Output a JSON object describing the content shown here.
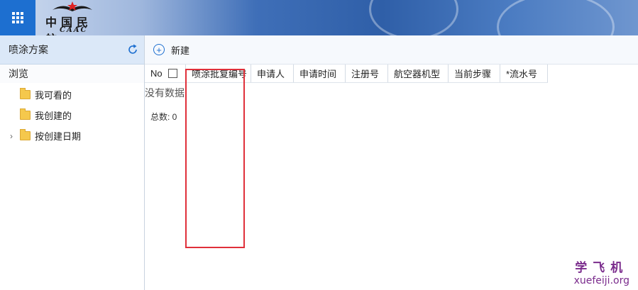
{
  "header": {
    "apps_icon": "grid-icon",
    "logo_cn": "中国民航",
    "logo_en": "CAAC",
    "colors": {
      "banner": "#2f5fa8",
      "apps_button": "#1d6fd0"
    }
  },
  "sidebar": {
    "title": "喷涂方案",
    "refresh_icon": "refresh-icon",
    "browse_label": "浏览",
    "items": [
      {
        "label": "我可看的",
        "icon": "folder-icon"
      },
      {
        "label": "我创建的",
        "icon": "folder-icon"
      },
      {
        "label": "按创建日期",
        "icon": "folder-icon",
        "expandable": true
      }
    ]
  },
  "toolbar": {
    "new_label": "新建",
    "new_icon": "plus-circle-icon"
  },
  "table": {
    "columns": [
      "No",
      "喷涂批复编号",
      "申请人",
      "申请时间",
      "注册号",
      "航空器机型",
      "当前步骤",
      "*流水号"
    ],
    "empty_text": "没有数据",
    "total_label": "总数: 0"
  },
  "watermark": {
    "line1": "学飞机",
    "line2": "xuefeiji.org",
    "color": "#7a2b8c"
  },
  "highlight_color": "#e0303a"
}
